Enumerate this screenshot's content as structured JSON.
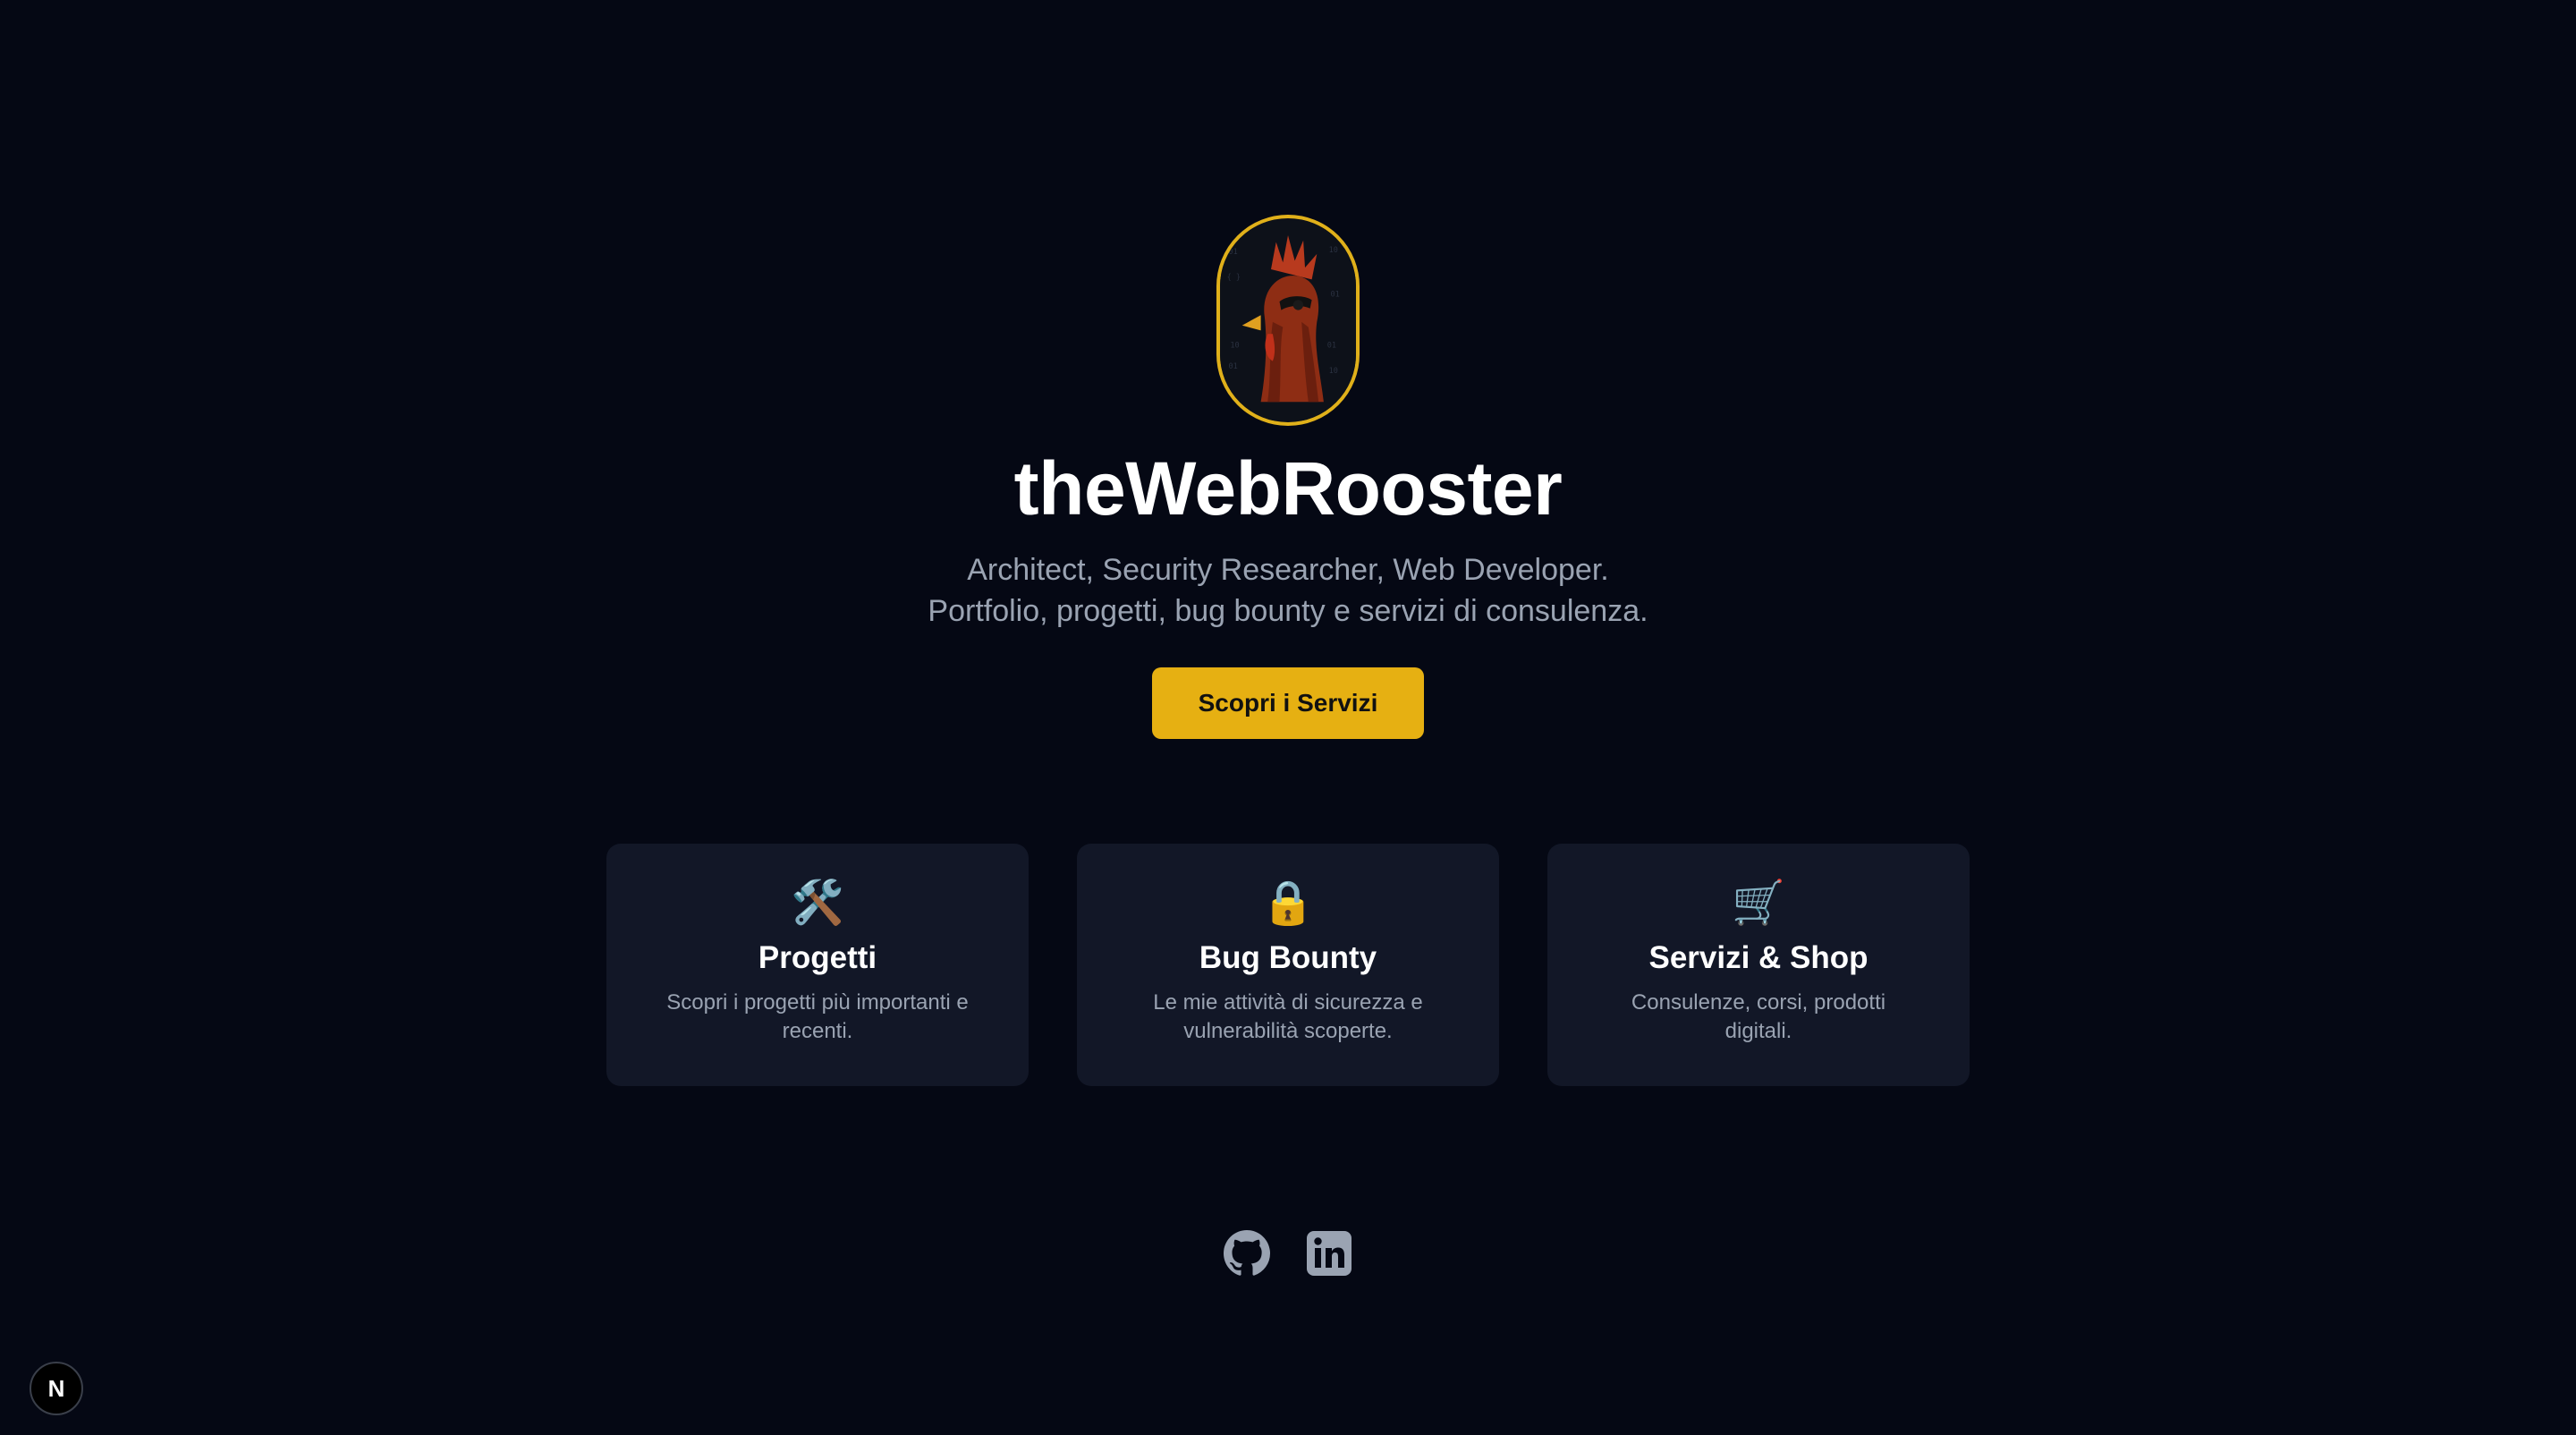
{
  "hero": {
    "logo_icon": "rooster-logo",
    "title": "theWebRooster",
    "tagline_line1": "Architect, Security Researcher, Web Developer.",
    "tagline_line2": "Portfolio, progetti, bug bounty e servizi di consulenza.",
    "cta_label": "Scopri i Servizi"
  },
  "cards": [
    {
      "icon": "🛠️",
      "icon_name": "tools-icon",
      "title": "Progetti",
      "description": "Scopri i progetti più importanti e recenti."
    },
    {
      "icon": "🔒",
      "icon_name": "lock-icon",
      "title": "Bug Bounty",
      "description": "Le mie attività di sicurezza e vulnerabilità scoperte."
    },
    {
      "icon": "🛒",
      "icon_name": "cart-icon",
      "title": "Servizi & Shop",
      "description": "Consulenze, corsi, prodotti digitali."
    }
  ],
  "social": [
    {
      "icon_name": "github-icon"
    },
    {
      "icon_name": "linkedin-icon"
    }
  ],
  "dev_badge": {
    "label": "N",
    "icon_name": "nextjs-icon"
  },
  "colors": {
    "background": "#050814",
    "card": "#121727",
    "accent": "#e6b012",
    "muted_text": "#9aa3b2"
  }
}
